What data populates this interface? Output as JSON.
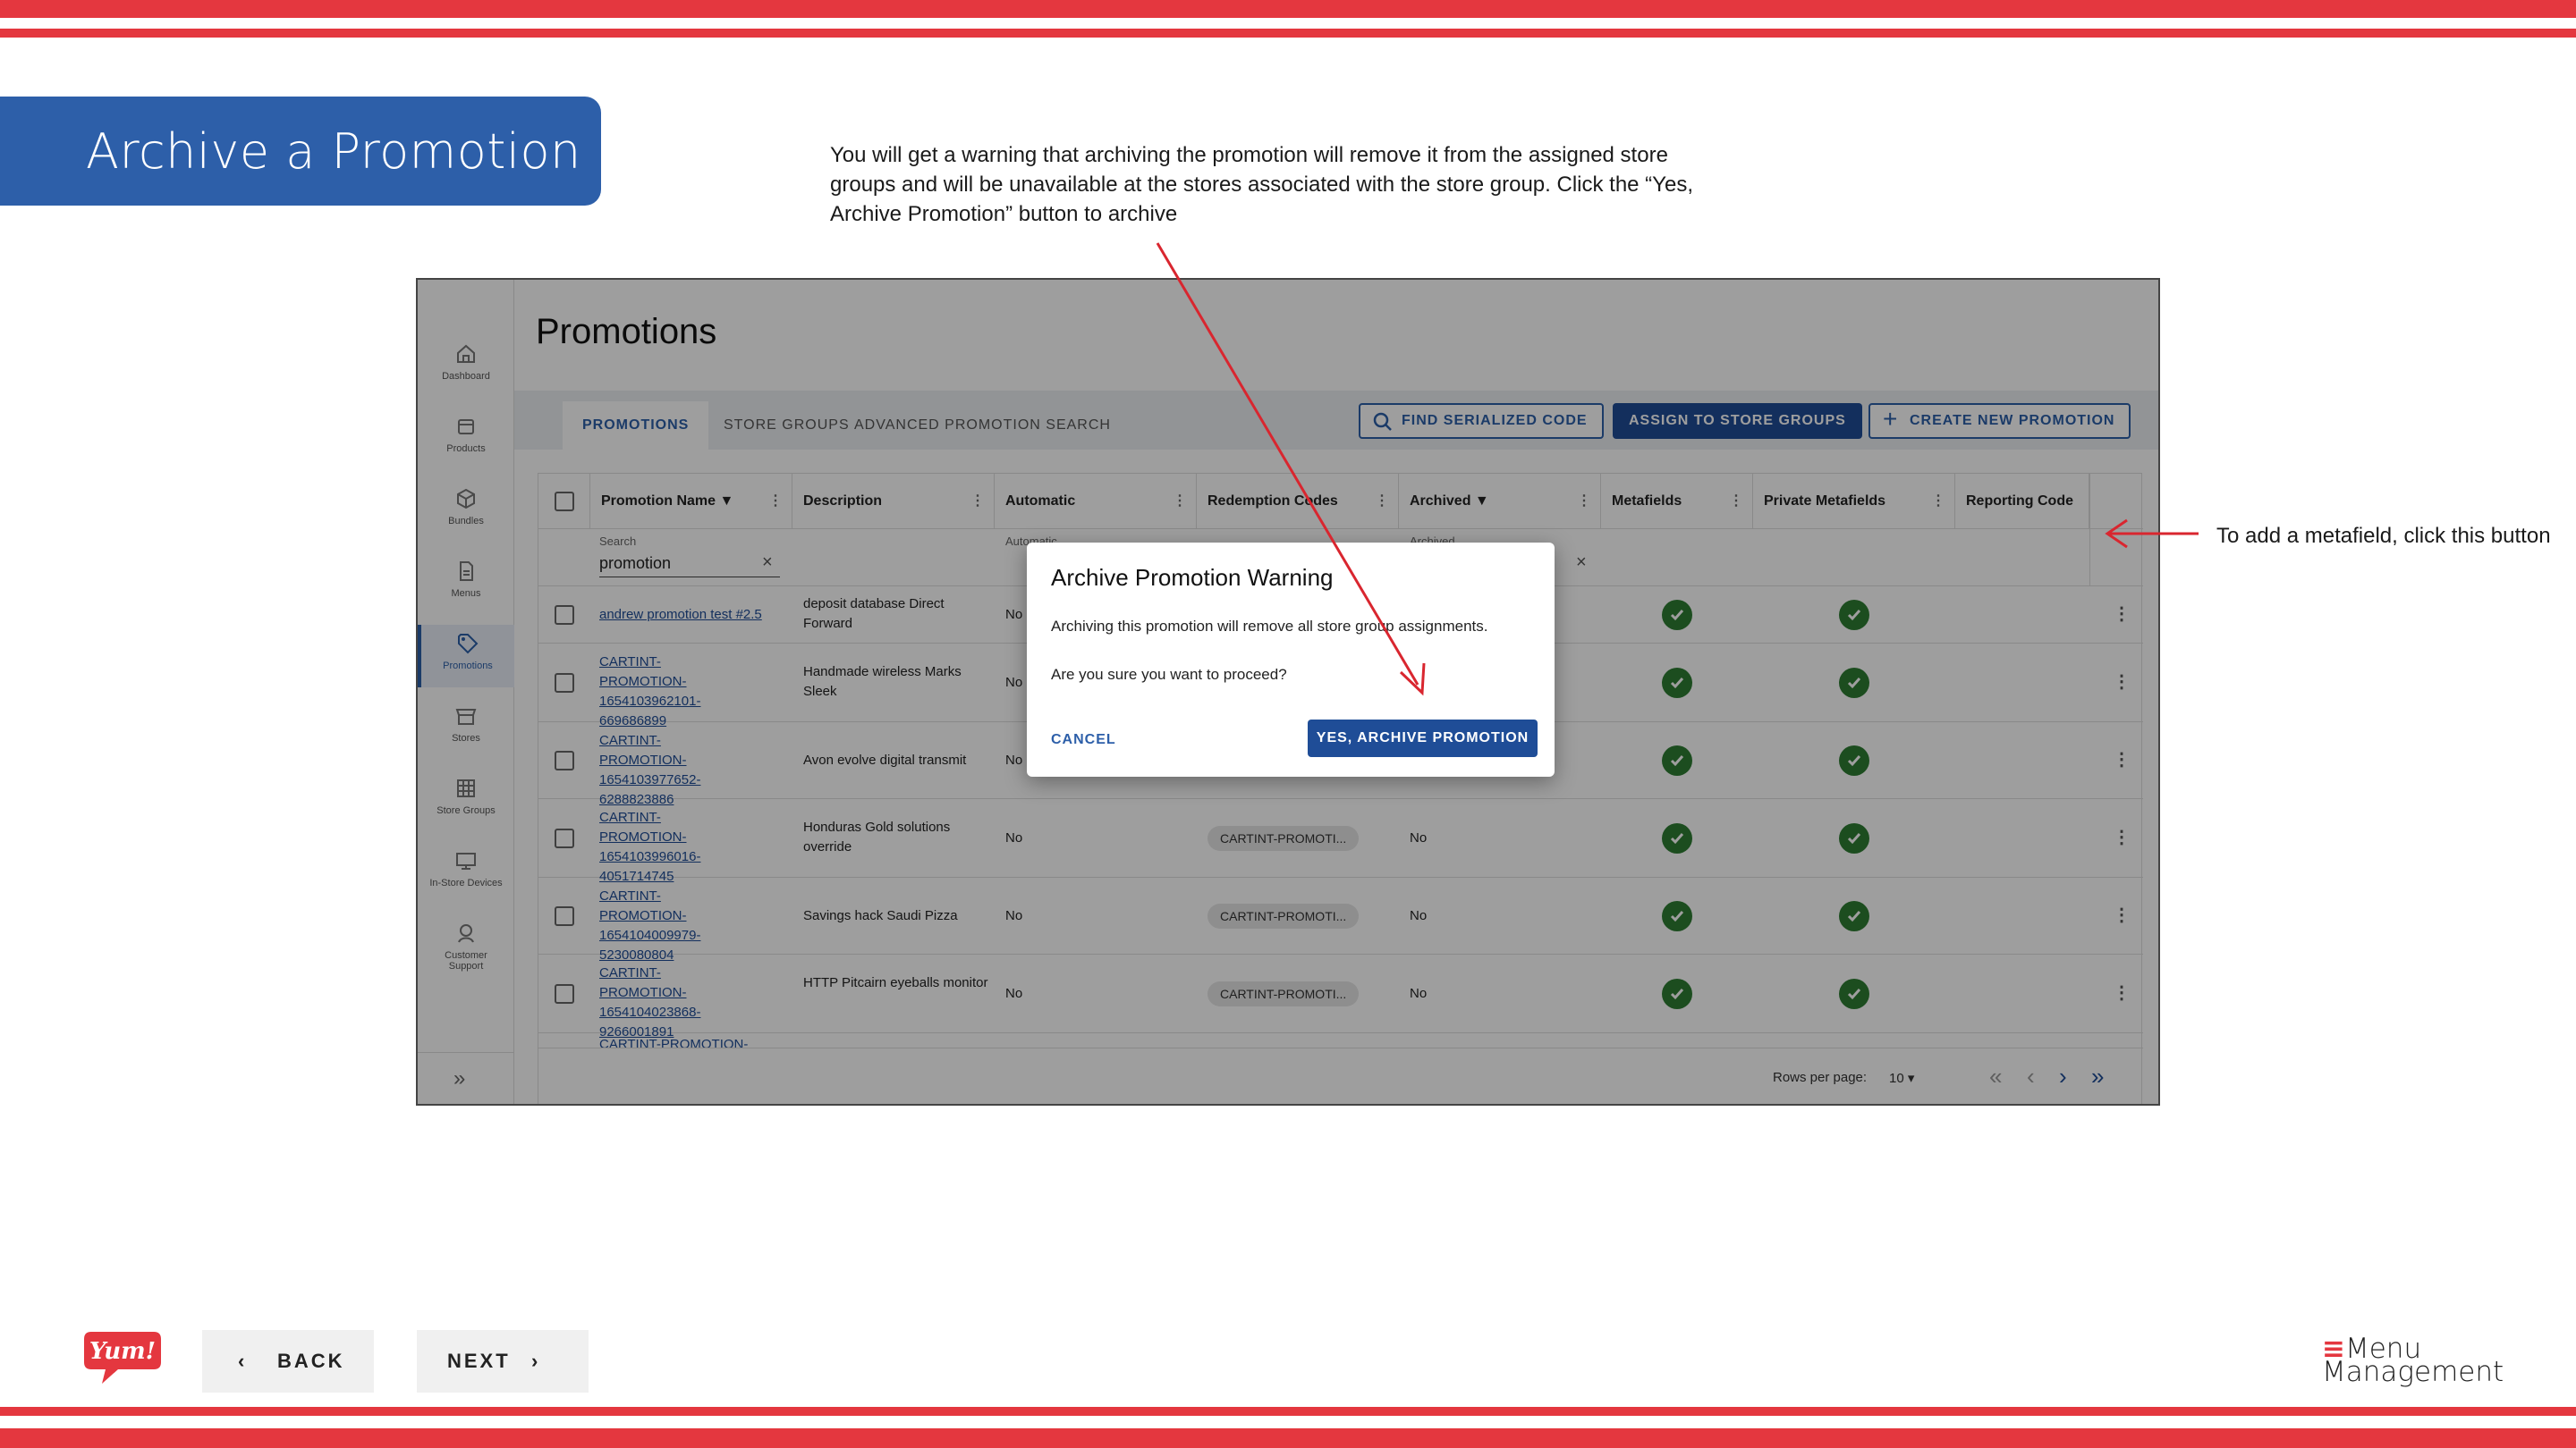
{
  "slide": {
    "title": "Archive a Promotion",
    "callout_top": "You will get a warning that archiving the promotion will remove it from the assigned store groups and will be unavailable at the stores associated with the store group. Click the “Yes, Archive Promotion” button to archive",
    "callout_right": "To add a metafield, click this button",
    "back_label": "BACK",
    "next_label": "NEXT",
    "logo_left_text": "Yum!",
    "logo_right_line1": "Menu",
    "logo_right_line2": "Management",
    "accent_color": "#e4373f",
    "brand_blue": "#2d5fa9"
  },
  "app": {
    "sidebar": [
      {
        "label": "Dashboard",
        "icon": "home-icon"
      },
      {
        "label": "Products",
        "icon": "box-icon"
      },
      {
        "label": "Bundles",
        "icon": "cube-icon"
      },
      {
        "label": "Menus",
        "icon": "document-icon"
      },
      {
        "label": "Promotions",
        "icon": "tag-icon",
        "active": true
      },
      {
        "label": "Stores",
        "icon": "store-icon"
      },
      {
        "label": "Store Groups",
        "icon": "grid-icon"
      },
      {
        "label": "In-Store Devices",
        "icon": "monitor-icon"
      },
      {
        "label": "Customer Support",
        "icon": "support-icon"
      }
    ],
    "expand_label": "»",
    "page_title": "Promotions",
    "tabs": [
      "PROMOTIONS",
      "STORE GROUPS",
      "ADVANCED PROMOTION SEARCH"
    ],
    "find_serialized": "FIND SERIALIZED CODE",
    "assign_store_groups": "ASSIGN TO STORE GROUPS",
    "create_new": "CREATE NEW PROMOTION",
    "columns": [
      "Promotion Name",
      "Description",
      "Automatic",
      "Redemption Codes",
      "Archived",
      "Metafields",
      "Private Metafields",
      "Reporting Code"
    ],
    "filter": {
      "label": "Search",
      "value": "promotion",
      "automatic_label": "Automatic",
      "archived_label": "Archived"
    },
    "rows": [
      {
        "name": "andrew promotion test #2.5",
        "description": "deposit database Direct Forward",
        "automatic": "No",
        "code": "",
        "archived": ""
      },
      {
        "name": "CARTINT-PROMOTION-1654103962101-669686899",
        "description": "Handmade wireless Marks Sleek",
        "automatic": "No",
        "code": "",
        "archived": ""
      },
      {
        "name": "CARTINT-PROMOTION-1654103977652-6288823886",
        "description": "Avon evolve digital transmit",
        "automatic": "No",
        "code": "",
        "archived": ""
      },
      {
        "name": "CARTINT-PROMOTION-1654103996016-4051714745",
        "description": "Honduras Gold solutions override",
        "automatic": "No",
        "code": "CARTINT-PROMOTI...",
        "archived": "No"
      },
      {
        "name": "CARTINT-PROMOTION-1654104009979-5230080804",
        "description": "Savings hack Saudi Pizza",
        "automatic": "No",
        "code": "CARTINT-PROMOTI...",
        "archived": "No"
      },
      {
        "name": "CARTINT-PROMOTION-1654104023868-9266001891",
        "description": "HTTP Pitcairn eyeballs monitor",
        "automatic": "No",
        "code": "CARTINT-PROMOTI...",
        "archived": "No"
      }
    ],
    "partial_row": "CARTINT-PROMOTION-",
    "pager": {
      "label": "Rows per page:",
      "value": "10"
    },
    "dialog": {
      "title": "Archive Promotion Warning",
      "body1": "Archiving this promotion will remove all store group assignments.",
      "body2": "Are you sure you want to proceed?",
      "cancel": "CANCEL",
      "confirm": "YES, ARCHIVE PROMOTION"
    }
  }
}
